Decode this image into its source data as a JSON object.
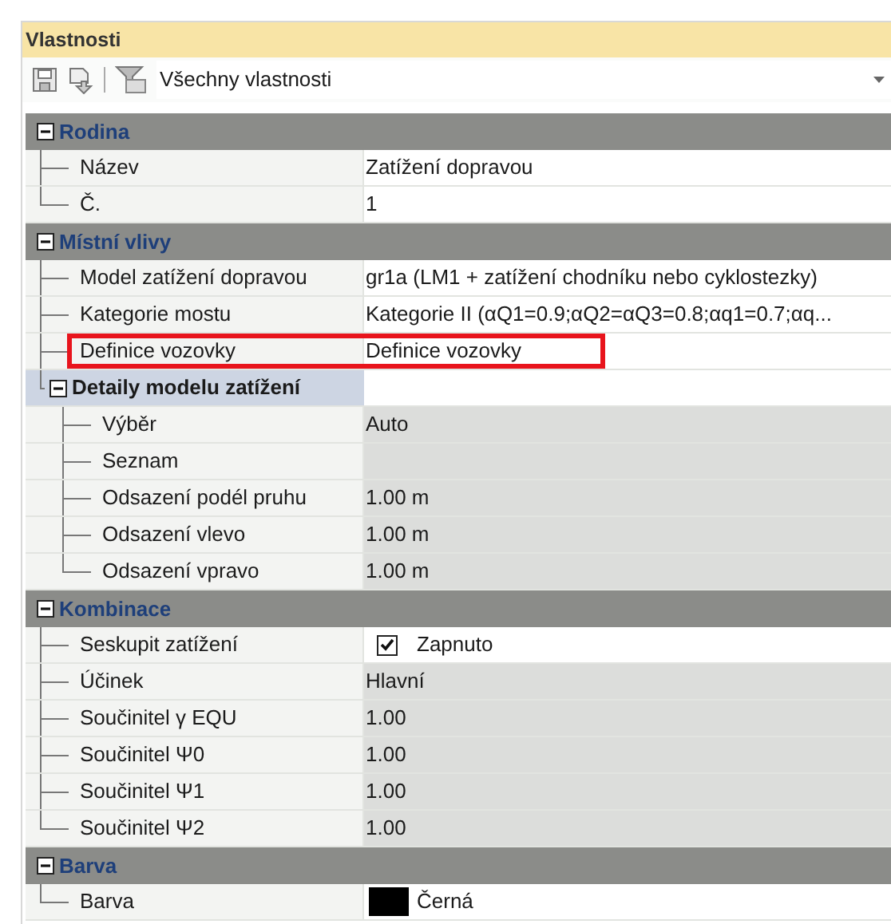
{
  "panel": {
    "title": "Vlastnosti"
  },
  "toolbar": {
    "filter": "Všechny vlastnosti"
  },
  "sections": [
    {
      "title": "Rodina",
      "expanded": true,
      "rows": [
        {
          "kind": "text",
          "label": "Název",
          "value": "Zatížení dopravou",
          "readonly": false,
          "highlighted": false
        },
        {
          "kind": "text",
          "label": "Č.",
          "value": "1",
          "readonly": false,
          "highlighted": false
        }
      ]
    },
    {
      "title": "Místní vlivy",
      "expanded": true,
      "rows": [
        {
          "kind": "text",
          "label": "Model zatížení dopravou",
          "value": "gr1a (LM1 + zatížení chodníku nebo cyklostezky)",
          "readonly": false,
          "highlighted": false
        },
        {
          "kind": "text",
          "label": "Kategorie mostu",
          "value": "Kategorie II (αQ1=0.9;αQ2=αQ3=0.8;αq1=0.7;αq...",
          "readonly": false,
          "highlighted": false
        },
        {
          "kind": "text",
          "label": "Definice vozovky",
          "value": "Definice vozovky",
          "readonly": false,
          "highlighted": true
        },
        {
          "kind": "group",
          "label": "Detaily modelu zatížení",
          "expanded": true,
          "children": [
            {
              "kind": "text",
              "label": "Výběr",
              "value": "Auto",
              "readonly": true,
              "highlighted": false
            },
            {
              "kind": "text",
              "label": "Seznam",
              "readonly": true,
              "highlighted": false
            },
            {
              "kind": "text",
              "label": "Odsazení podél pruhu",
              "value": "1.00 m",
              "readonly": true,
              "highlighted": false
            },
            {
              "kind": "text",
              "label": "Odsazení vlevo",
              "value": "1.00 m",
              "readonly": true,
              "highlighted": false
            },
            {
              "kind": "text",
              "label": "Odsazení vpravo",
              "value": "1.00 m",
              "readonly": true,
              "highlighted": false
            }
          ]
        }
      ]
    },
    {
      "title": "Kombinace",
      "expanded": true,
      "rows": [
        {
          "kind": "checkbox",
          "label": "Seskupit zatížení",
          "value": "Zapnuto",
          "checked": true,
          "readonly": false,
          "highlighted": false
        },
        {
          "kind": "text",
          "label": "Účinek",
          "value": "Hlavní",
          "readonly": true,
          "highlighted": false
        },
        {
          "kind": "text",
          "label": "Součinitel γ EQU",
          "value": "1.00",
          "readonly": true,
          "highlighted": false
        },
        {
          "kind": "text",
          "label": "Součinitel Ψ0",
          "value": "1.00",
          "readonly": true,
          "highlighted": false
        },
        {
          "kind": "text",
          "label": "Součinitel Ψ1",
          "value": "1.00",
          "readonly": true,
          "highlighted": false
        },
        {
          "kind": "text",
          "label": "Součinitel Ψ2",
          "value": "1.00",
          "readonly": true,
          "highlighted": false
        }
      ]
    },
    {
      "title": "Barva",
      "expanded": true,
      "rows": [
        {
          "kind": "color",
          "label": "Barva",
          "value": "Černá",
          "color": "#000000",
          "readonly": false,
          "highlighted": false
        }
      ]
    }
  ]
}
